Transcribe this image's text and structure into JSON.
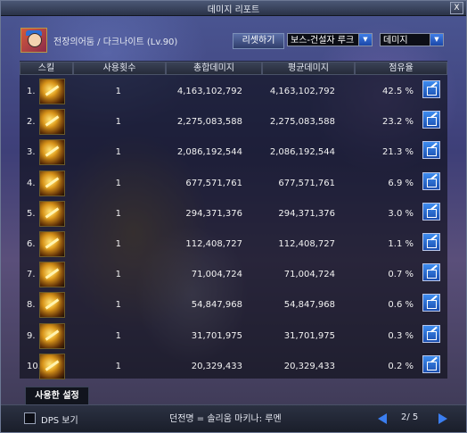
{
  "window": {
    "title": "데미지 리포트",
    "close_label": "X"
  },
  "header": {
    "character": "전장의어둠 / 다크나이트 (Lv.90)",
    "reset_label": "리셋하기",
    "boss_select": "보스-건설자 루크",
    "metric_select": "데미지"
  },
  "columns": [
    "스킬",
    "사용횟수",
    "총합데미지",
    "평균데미지",
    "점유율"
  ],
  "rows": [
    {
      "rank": "1.",
      "uses": "1",
      "total": "4,163,102,792",
      "avg": "4,163,102,792",
      "share": "42.5 %"
    },
    {
      "rank": "2.",
      "uses": "1",
      "total": "2,275,083,588",
      "avg": "2,275,083,588",
      "share": "23.2 %"
    },
    {
      "rank": "3.",
      "uses": "1",
      "total": "2,086,192,544",
      "avg": "2,086,192,544",
      "share": "21.3 %"
    },
    {
      "rank": "4.",
      "uses": "1",
      "total": "677,571,761",
      "avg": "677,571,761",
      "share": "6.9 %"
    },
    {
      "rank": "5.",
      "uses": "1",
      "total": "294,371,376",
      "avg": "294,371,376",
      "share": "3.0 %"
    },
    {
      "rank": "6.",
      "uses": "1",
      "total": "112,408,727",
      "avg": "112,408,727",
      "share": "1.1 %"
    },
    {
      "rank": "7.",
      "uses": "1",
      "total": "71,004,724",
      "avg": "71,004,724",
      "share": "0.7 %"
    },
    {
      "rank": "8.",
      "uses": "1",
      "total": "54,847,968",
      "avg": "54,847,968",
      "share": "0.6 %"
    },
    {
      "rank": "9.",
      "uses": "1",
      "total": "31,701,975",
      "avg": "31,701,975",
      "share": "0.3 %"
    },
    {
      "rank": "10.",
      "uses": "1",
      "total": "20,329,433",
      "avg": "20,329,433",
      "share": "0.2 %"
    }
  ],
  "footer": {
    "settings_tab": "사용한 설정",
    "dps_label": "DPS 보기",
    "dungeon_info": "던전명 = 솔리움 마키나: 루멘",
    "page": "2/ 5"
  },
  "colors": {
    "accent": "#3b7ef0",
    "title_bar": "#3a4560"
  }
}
